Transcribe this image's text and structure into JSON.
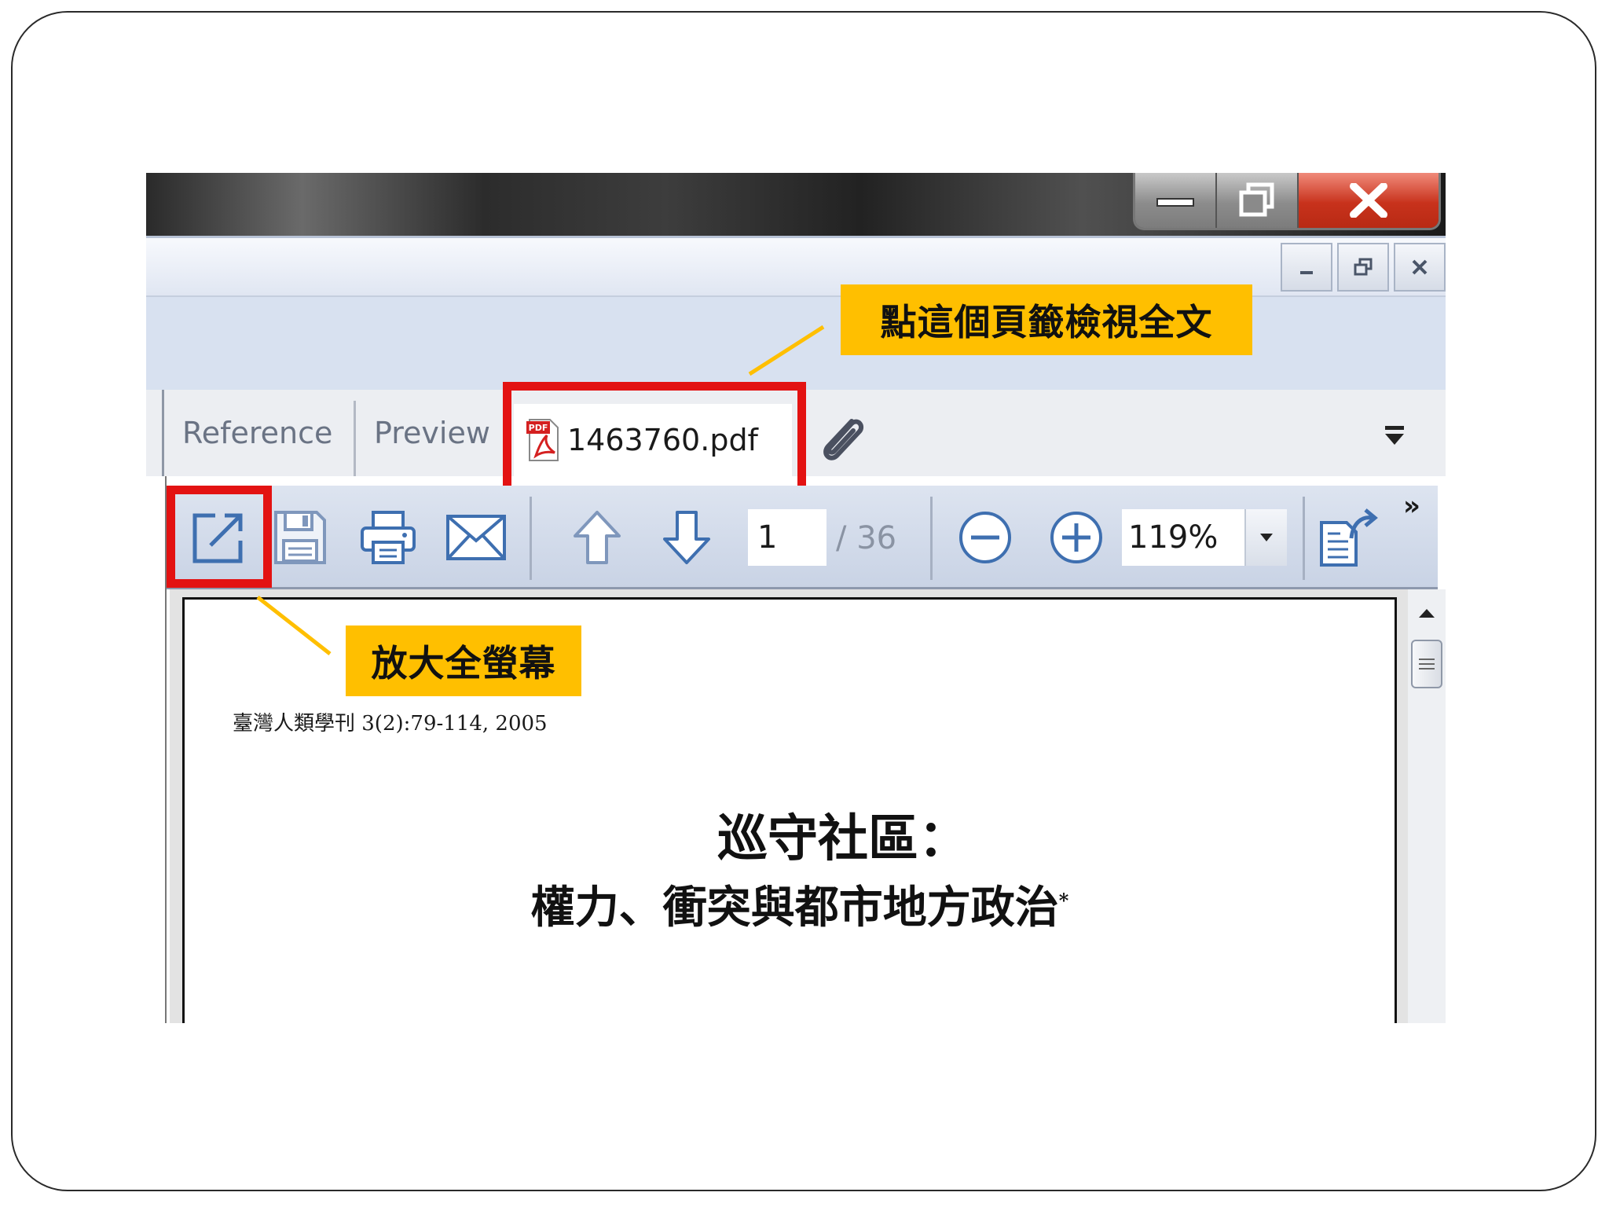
{
  "tabs": {
    "reference": "Reference",
    "preview": "Preview",
    "pdf": "1463760.pdf"
  },
  "callouts": {
    "tab": "點這個頁籤檢視全文",
    "fullscreen": "放大全螢幕"
  },
  "toolbar": {
    "page_current": "1",
    "page_total": "/ 36",
    "zoom": "119%",
    "overflow": "»"
  },
  "document": {
    "journal_line": "臺灣人類學刊 3(2):79-114, 2005",
    "title": "巡守社區：",
    "subtitle": "權力、衝突與都市地方政治",
    "subtitle_mark": "*"
  },
  "colors": {
    "highlight": "#e31212",
    "callout": "#ffbf00",
    "toolbar_icon": "#3e6fb0"
  },
  "icons": {
    "open_external": "open-in-new-window-icon",
    "save": "save-icon",
    "print": "print-icon",
    "email": "email-icon",
    "prev_page": "arrow-up-icon",
    "next_page": "arrow-down-icon",
    "zoom_out": "zoom-out-icon",
    "zoom_in": "zoom-in-icon",
    "rotate": "rotate-page-icon",
    "attachment": "paperclip-icon"
  }
}
